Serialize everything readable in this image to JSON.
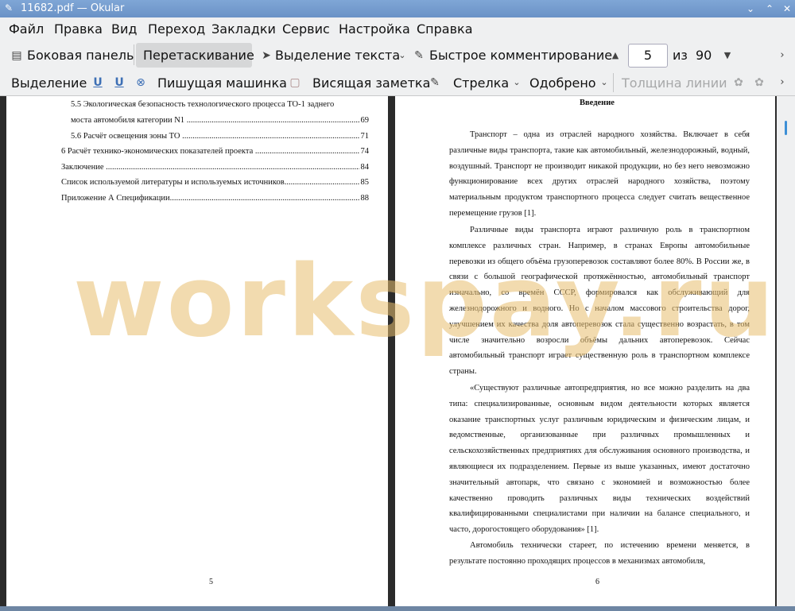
{
  "window": {
    "title": "11682.pdf — Okular"
  },
  "menubar": {
    "items": [
      "Файл",
      "Правка",
      "Вид",
      "Переход",
      "Закладки",
      "Сервис",
      "Настройка",
      "Справка"
    ]
  },
  "toolbar": {
    "sidebar_label": "Боковая панель",
    "drag_label": "Перетаскивание",
    "text_select_label": "Выделение текста",
    "quick_comment_label": "Быстрое комментирование",
    "page_current": "5",
    "page_of": "из",
    "page_total": "90"
  },
  "annotations_bar": {
    "highlight_label": "Выделение",
    "typewriter_label": "Пишущая машинка",
    "sticky_note_label": "Висящая заметка",
    "arrow_label": "Стрелка",
    "stamp_label": "Одобрено",
    "line_width_label": "Толщина линии"
  },
  "page_left": {
    "toc": [
      {
        "text": "5.5 Экологическая безопасность технологического процесса ТО-1 заднего",
        "page": ""
      },
      {
        "text": "моста автомобиля категории N1 ",
        "page": "69"
      },
      {
        "text": "5.6 Расчёт освещения зоны ТО ",
        "page": "71"
      },
      {
        "text": "6 Расчёт технико-экономических показателей проекта ",
        "page": "74"
      },
      {
        "text": "Заключение ",
        "page": "84"
      },
      {
        "text": "Список используемой литературы и используемых источников",
        "page": "85"
      },
      {
        "text": "Приложение А Спецификации",
        "page": "88"
      }
    ],
    "page_number": "5"
  },
  "page_right": {
    "heading": "Введение",
    "paragraphs": [
      "Транспорт – одна из отраслей народного хозяйства. Включает в себя различные виды транспорта, такие как автомобильный, железнодорожный, водный, воздушный. Транспорт не производит никакой продукции, но без него невозможно функционирование всех других отраслей народного хозяйства, поэтому материальным продуктом транспортного процесса следует считать вещественное перемещение грузов [1].",
      "Различные виды транспорта играют различную роль в транспортном комплексе различных стран. Например, в странах Европы автомобильные перевозки из общего объёма грузоперевозок составляют более 80%. В России же, в связи с большой географической протяжённостью, автомобильный транспорт изначально, со времён СССР, формировался как обслуживающий для железнодорожного и водного. Но с началом массового строительства дорог, улучшением их качества доля автоперевозок стала существенно возрастать, в том числе значительно возросли объёмы дальних автоперевозок. Сейчас автомобильный транспорт играет существенную роль в транспортном комплексе страны.",
      "«Существуют различные автопредприятия, но все можно разделить на два типа: специализированные, основным видом деятельности которых является оказание транспортных услуг различным юридическим и физическим лицам, и ведомственные, организованные при различных промышленных и сельскохозяйственных предприятиях для обслуживания основного производства, и являющиеся их подразделением. Первые из выше указанных, имеют достаточно значительный автопарк, что связано с экономией и возможностью более качественно проводить различных виды технических воздействий квалифицированными специалистами при наличии на балансе специального, и часто, дорогостоящего оборудования» [1].",
      "Автомобиль технически стареет, по истечению времени меняется, в результате постоянно проходящих процессов в механизмах автомобиля,"
    ],
    "page_number": "6"
  },
  "watermark": "workspay.ru",
  "colors": {
    "titlebar": "#6f97cb",
    "toolbar_bg": "#eff0f1",
    "active_button": "#d6d7d8",
    "accent_scroll": "#3d8fd6",
    "watermark": "#e8be6e"
  }
}
